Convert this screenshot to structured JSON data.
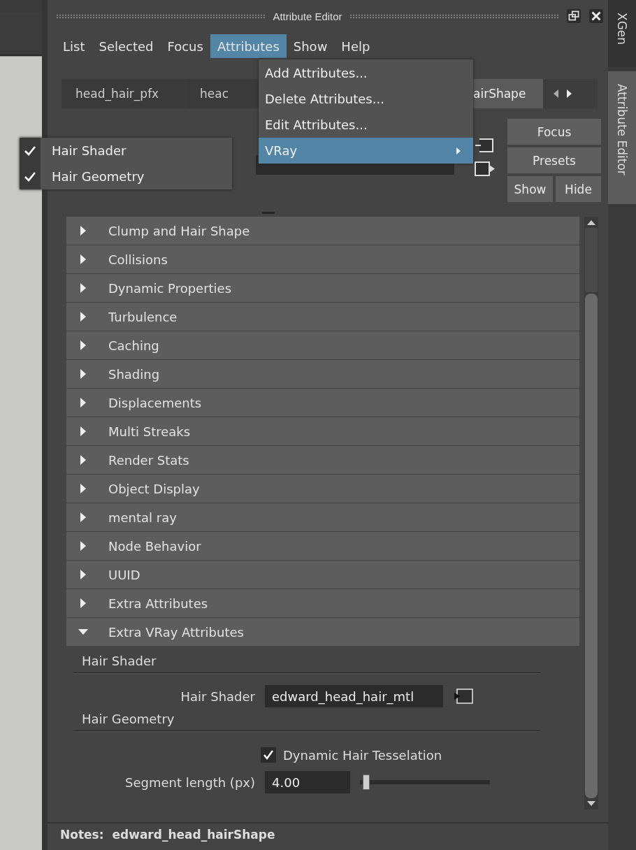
{
  "window": {
    "title": "Attribute Editor"
  },
  "menu_bar": [
    {
      "label": "List",
      "selected": false
    },
    {
      "label": "Selected",
      "selected": false
    },
    {
      "label": "Focus",
      "selected": false
    },
    {
      "label": "Attributes",
      "selected": true
    },
    {
      "label": "Show",
      "selected": false
    },
    {
      "label": "Help",
      "selected": false
    }
  ],
  "attributes_menu": [
    {
      "label": "Add Attributes...",
      "kind": "action",
      "selected": false
    },
    {
      "label": "Delete Attributes...",
      "kind": "action",
      "selected": false
    },
    {
      "label": "Edit Attributes...",
      "kind": "action",
      "selected": false
    },
    {
      "label": "VRay",
      "kind": "submenu",
      "selected": true
    }
  ],
  "vray_submenu": [
    {
      "label": "Hair Shader",
      "checked": true
    },
    {
      "label": "Hair Geometry",
      "checked": true
    }
  ],
  "node_tabs": [
    {
      "label": "head_hair_pfx",
      "selected": false
    },
    {
      "label": "heac",
      "selected": false
    },
    {
      "label": "airShape",
      "selected": true
    }
  ],
  "side_tabs": [
    {
      "label": "XGen",
      "selected": false
    },
    {
      "label": "Attribute Editor",
      "selected": true
    }
  ],
  "buttons": {
    "focus": "Focus",
    "presets": "Presets",
    "show": "Show",
    "hide": "Hide"
  },
  "sections": [
    {
      "label": "Clump and Hair Shape",
      "expanded": false
    },
    {
      "label": "Collisions",
      "expanded": false
    },
    {
      "label": "Dynamic Properties",
      "expanded": false
    },
    {
      "label": "Turbulence",
      "expanded": false
    },
    {
      "label": "Caching",
      "expanded": false
    },
    {
      "label": "Shading",
      "expanded": false
    },
    {
      "label": "Displacements",
      "expanded": false
    },
    {
      "label": "Multi Streaks",
      "expanded": false
    },
    {
      "label": "Render Stats",
      "expanded": false
    },
    {
      "label": "Object Display",
      "expanded": false
    },
    {
      "label": "mental ray",
      "expanded": false
    },
    {
      "label": "Node Behavior",
      "expanded": false
    },
    {
      "label": "UUID",
      "expanded": false
    },
    {
      "label": "Extra Attributes",
      "expanded": false
    },
    {
      "label": "Extra VRay Attributes",
      "expanded": true
    }
  ],
  "hair_shader": {
    "heading": "Hair Shader",
    "label": "Hair Shader",
    "value": "edward_head_hair_mtl"
  },
  "hair_geometry": {
    "heading": "Hair Geometry",
    "checkbox": {
      "label": "Dynamic Hair Tesselation",
      "checked": true
    },
    "segment": {
      "label": "Segment length (px)",
      "value": "4.00",
      "level": 0.05
    }
  },
  "notes": {
    "label": "Notes:",
    "value": "edward_head_hairShape"
  }
}
